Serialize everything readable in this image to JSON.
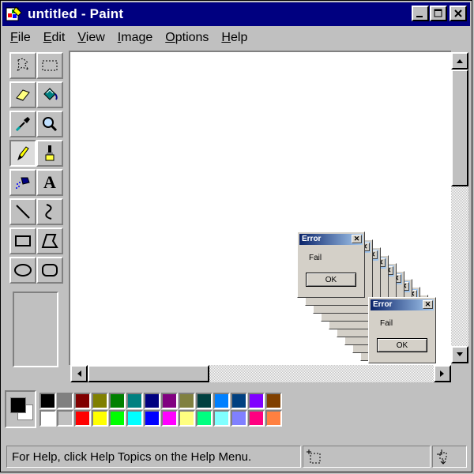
{
  "window": {
    "title": "untitled - Paint",
    "minimize_glyph": "_",
    "maximize_glyph": "□",
    "close_glyph": "✕"
  },
  "menu": {
    "items": [
      {
        "underline": "F",
        "rest": "ile"
      },
      {
        "underline": "E",
        "rest": "dit"
      },
      {
        "underline": "V",
        "rest": "iew"
      },
      {
        "underline": "I",
        "rest": "mage"
      },
      {
        "underline": "O",
        "rest": "ptions"
      },
      {
        "underline": "H",
        "rest": "elp"
      }
    ]
  },
  "tools": [
    {
      "icon": "free-form-select-icon"
    },
    {
      "icon": "rect-select-icon"
    },
    {
      "icon": "eraser-icon"
    },
    {
      "icon": "fill-bucket-icon"
    },
    {
      "icon": "color-picker-icon"
    },
    {
      "icon": "magnifier-icon"
    },
    {
      "icon": "pencil-icon",
      "selected": true
    },
    {
      "icon": "brush-icon"
    },
    {
      "icon": "airbrush-icon"
    },
    {
      "icon": "text-icon",
      "glyph": "A"
    },
    {
      "icon": "line-icon"
    },
    {
      "icon": "curve-icon"
    },
    {
      "icon": "rectangle-icon"
    },
    {
      "icon": "polygon-icon"
    },
    {
      "icon": "ellipse-icon"
    },
    {
      "icon": "rounded-rect-icon"
    }
  ],
  "palette": {
    "foreground": "#000000",
    "background": "#ffffff",
    "row1": [
      "#000000",
      "#808080",
      "#800000",
      "#808000",
      "#008000",
      "#008080",
      "#000080",
      "#800080",
      "#808040",
      "#004040",
      "#0080ff",
      "#004080",
      "#8000ff",
      "#804000"
    ],
    "row2": [
      "#ffffff",
      "#c0c0c0",
      "#ff0000",
      "#ffff00",
      "#00ff00",
      "#00ffff",
      "#0000ff",
      "#ff00ff",
      "#ffff80",
      "#00ff80",
      "#80ffff",
      "#8080ff",
      "#ff0080",
      "#ff8040"
    ]
  },
  "dialogs": {
    "title": "Error",
    "message": "Fail",
    "ok_label": "OK",
    "close_glyph": "✕"
  },
  "status": {
    "help_text": "For Help, click Help Topics on the Help Menu."
  }
}
